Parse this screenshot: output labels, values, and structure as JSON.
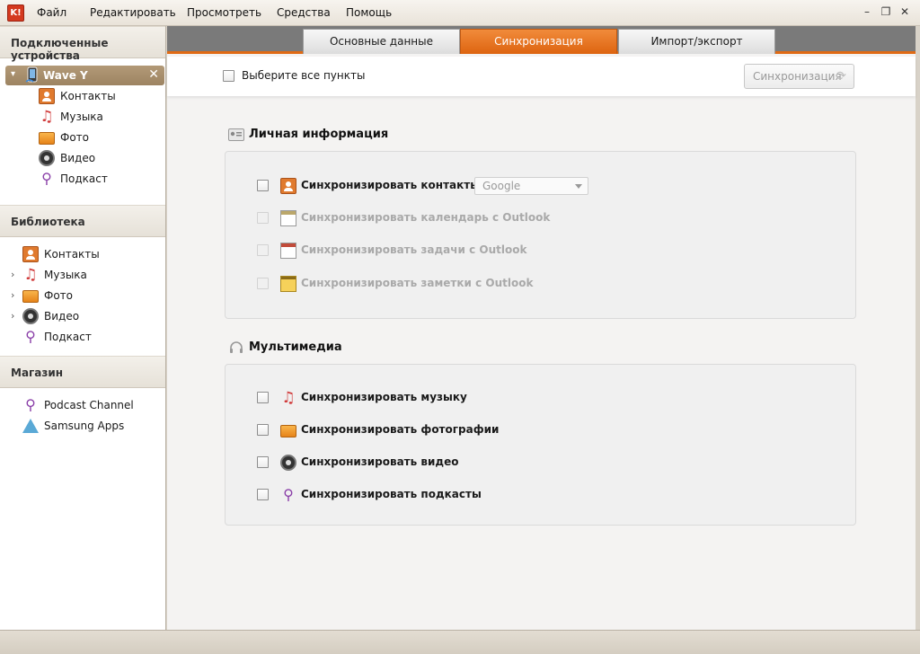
{
  "app": {
    "logo_text": "K!"
  },
  "menu": {
    "file": "Файл",
    "edit": "Редактировать",
    "view": "Просмотреть",
    "tools": "Средства",
    "help": "Помощь"
  },
  "window": {
    "minimize": "–",
    "restore": "❐",
    "close": "✕"
  },
  "sidebar": {
    "connected_title": "Подключенные устройства",
    "device": {
      "name": "Wave Y",
      "close": "✕",
      "chevron": "▾"
    },
    "device_items": [
      {
        "label": "Контакты",
        "icon": "contacts-icon"
      },
      {
        "label": "Музыка",
        "icon": "music-icon"
      },
      {
        "label": "Фото",
        "icon": "photo-icon"
      },
      {
        "label": "Видео",
        "icon": "video-icon"
      },
      {
        "label": "Подкаст",
        "icon": "podcast-icon"
      }
    ],
    "library_title": "Библиотека",
    "library_items": [
      {
        "label": "Контакты",
        "icon": "contacts-icon"
      },
      {
        "label": "Музыка",
        "icon": "music-icon",
        "expandable": true
      },
      {
        "label": "Фото",
        "icon": "photo-icon",
        "expandable": true
      },
      {
        "label": "Видео",
        "icon": "video-icon",
        "expandable": true
      },
      {
        "label": "Подкаст",
        "icon": "podcast-icon"
      }
    ],
    "store_title": "Магазин",
    "store_items": [
      {
        "label": "Podcast Channel",
        "icon": "podcast-icon"
      },
      {
        "label": "Samsung Apps",
        "icon": "samsung-apps-icon"
      }
    ]
  },
  "tabs": [
    {
      "label": "Основные данные",
      "active": false
    },
    {
      "label": "Синхронизация",
      "active": true
    },
    {
      "label": "Импорт/экспорт",
      "active": false
    }
  ],
  "toolbar": {
    "select_all_label": "Выберите все пункты",
    "sync_button": "Синхронизация",
    "sync_icon": "⟳"
  },
  "personal": {
    "title": "Личная информация",
    "options": [
      {
        "label": "Синхронизировать контакты с",
        "enabled": true,
        "icon": "contacts-icon"
      },
      {
        "label": "Синхронизировать календарь с Outlook",
        "enabled": false,
        "icon": "calendar-icon"
      },
      {
        "label": "Синхронизировать задачи с Outlook",
        "enabled": false,
        "icon": "tasks-icon"
      },
      {
        "label": "Синхронизировать заметки с Outlook",
        "enabled": false,
        "icon": "notes-icon"
      }
    ],
    "contacts_source": "Google"
  },
  "multimedia": {
    "title": "Мультимедиа",
    "options": [
      {
        "label": "Синхронизировать музыку",
        "enabled": true,
        "icon": "music-icon"
      },
      {
        "label": "Синхронизировать фотографии",
        "enabled": true,
        "icon": "photo-icon"
      },
      {
        "label": "Синхронизировать видео",
        "enabled": true,
        "icon": "video-icon"
      },
      {
        "label": "Синхронизировать подкасты",
        "enabled": true,
        "icon": "podcast-icon"
      }
    ]
  },
  "colors": {
    "accent": "#e06a14",
    "device_row": "#a88e6b",
    "tabbar": "#7a7a7a"
  }
}
